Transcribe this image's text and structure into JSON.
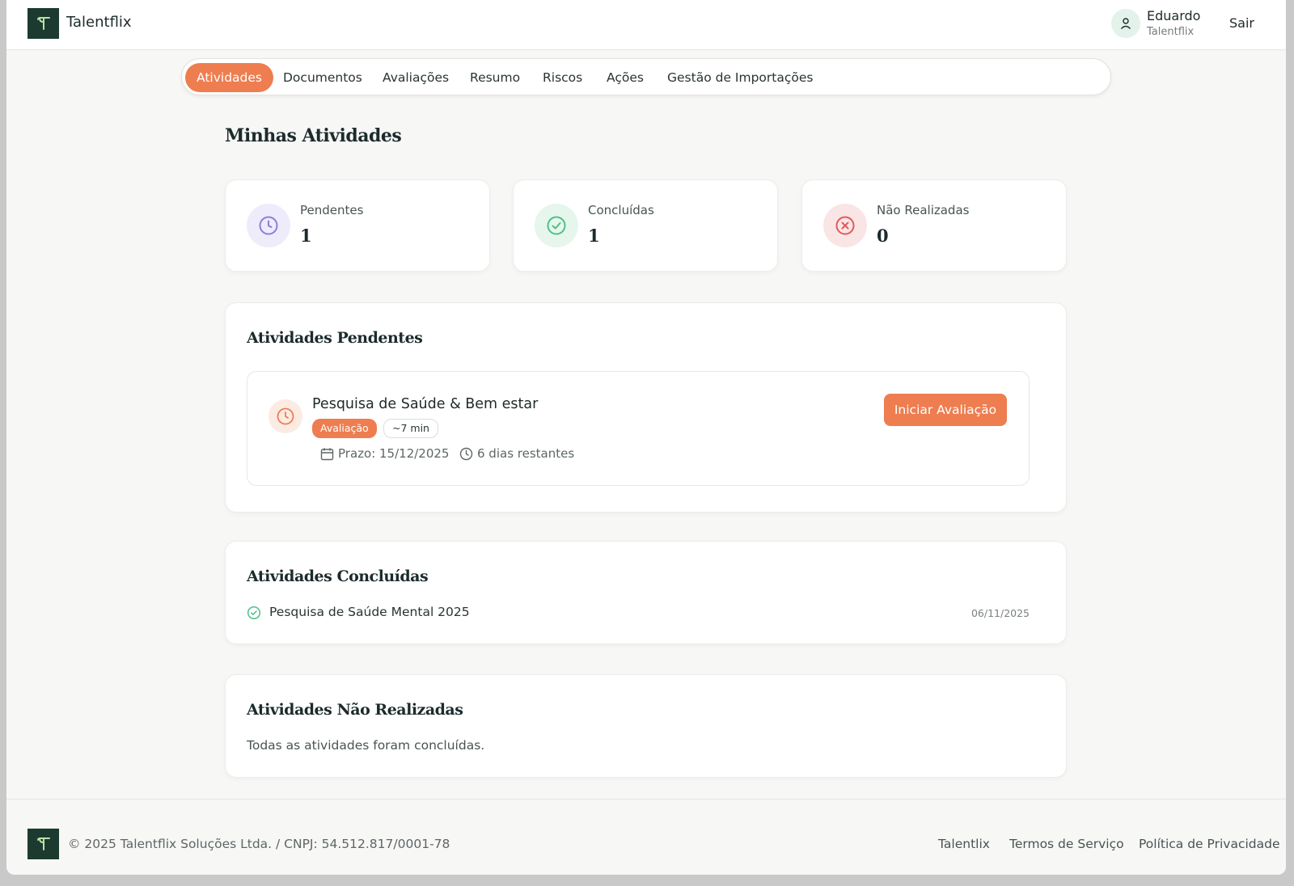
{
  "header": {
    "brand": "Talentflix",
    "user_name": "Eduardo",
    "user_org": "Talentflix",
    "logout_label": "Sair"
  },
  "tabs": [
    {
      "label": "Atividades",
      "active": true
    },
    {
      "label": "Documentos",
      "active": false
    },
    {
      "label": "Avaliações",
      "active": false
    },
    {
      "label": "Resumo",
      "active": false
    },
    {
      "label": "Riscos",
      "active": false
    },
    {
      "label": "Ações",
      "active": false
    },
    {
      "label": "Gestão de Importações",
      "active": false
    }
  ],
  "page": {
    "title": "Minhas Atividades"
  },
  "stats": [
    {
      "label": "Pendentes",
      "value": "1",
      "icon": "clock-icon",
      "color": "#8b7fd9"
    },
    {
      "label": "Concluídas",
      "value": "1",
      "icon": "check-circle-icon",
      "color": "#4fbf86"
    },
    {
      "label": "Não Realizadas",
      "value": "0",
      "icon": "x-circle-icon",
      "color": "#e05a5a"
    }
  ],
  "pending": {
    "title": "Atividades Pendentes",
    "task": {
      "title": "Pesquisa de Saúde & Bem estar",
      "type_badge": "Avaliação",
      "duration_badge": "~7 min",
      "deadline": "Prazo: 15/12/2025",
      "remaining": "6 dias restantes",
      "button_label": "Iniciar Avaliação"
    }
  },
  "completed": {
    "title": "Atividades Concluídas",
    "items": [
      {
        "title": "Pesquisa de Saúde Mental 2025",
        "date": "06/11/2025"
      }
    ]
  },
  "not_done": {
    "title": "Atividades Não Realizadas",
    "empty_text": "Todas as atividades foram concluídas."
  },
  "footer": {
    "copyright": "© 2025 Talentflix Soluções Ltda. / CNPJ: 54.512.817/0001-78",
    "links": [
      "Talentlix",
      "Termos de Serviço",
      "Política de Privacidade"
    ]
  },
  "colors": {
    "accent": "#ee7d50",
    "brand_dark": "#1d3a30"
  }
}
